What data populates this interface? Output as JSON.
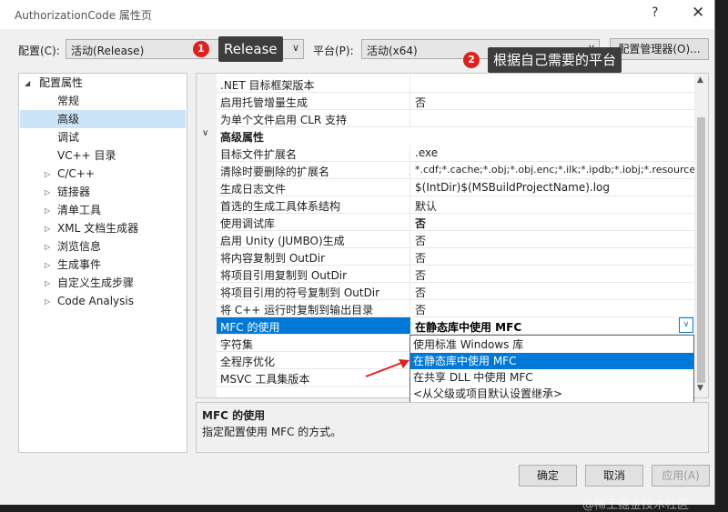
{
  "window": {
    "title": "AuthorizationCode 属性页",
    "help": "?",
    "close": "✕"
  },
  "toolbar": {
    "config_label": "配置(C):",
    "config_value": "活动(Release)",
    "platform_label": "平台(P):",
    "platform_value": "活动(x64)",
    "config_manager": "配置管理器(O)..."
  },
  "annotations": [
    {
      "number": "1",
      "text": "Release"
    },
    {
      "number": "2",
      "text": "根据自己需要的平台"
    }
  ],
  "tree": {
    "root": "配置属性",
    "items": [
      "常规",
      "高级",
      "调试",
      "VC++ 目录",
      "C/C++",
      "链接器",
      "清单工具",
      "XML 文档生成器",
      "浏览信息",
      "生成事件",
      "自定义生成步骤",
      "Code Analysis"
    ],
    "selected": "高级"
  },
  "grid": {
    "top_rows": [
      {
        "name": ".NET 目标框架版本",
        "value": ""
      },
      {
        "name": "启用托管增量生成",
        "value": "否"
      },
      {
        "name": "为单个文件启用 CLR 支持",
        "value": ""
      }
    ],
    "category": "高级属性",
    "rows": [
      {
        "name": "目标文件扩展名",
        "value": ".exe"
      },
      {
        "name": "清除时要删除的扩展名",
        "value": "*.cdf;*.cache;*.obj;*.obj.enc;*.ilk;*.ipdb;*.iobj;*.resources;"
      },
      {
        "name": "生成日志文件",
        "value": "$(IntDir)$(MSBuildProjectName).log"
      },
      {
        "name": "首选的生成工具体系结构",
        "value": "默认"
      },
      {
        "name": "使用调试库",
        "value": "否"
      },
      {
        "name": "启用 Unity (JUMBO)生成",
        "value": "否"
      },
      {
        "name": "将内容复制到 OutDir",
        "value": "否"
      },
      {
        "name": "将项目引用复制到 OutDir",
        "value": "否"
      },
      {
        "name": "将项目引用的符号复制到 OutDir",
        "value": "否"
      },
      {
        "name": "将 C++ 运行时复制到输出目录",
        "value": "否"
      },
      {
        "name": "MFC 的使用",
        "value": "在静态库中使用 MFC"
      },
      {
        "name": "字符集",
        "value": ""
      },
      {
        "name": "全程序优化",
        "value": ""
      },
      {
        "name": "MSVC 工具集版本",
        "value": ""
      }
    ]
  },
  "dropdown": {
    "options": [
      "使用标准 Windows 库",
      "在静态库中使用 MFC",
      "在共享 DLL 中使用 MFC",
      "<从父级或项目默认设置继承>"
    ],
    "selected": "在静态库中使用 MFC"
  },
  "description": {
    "title": "MFC 的使用",
    "text": "指定配置使用 MFC 的方式。"
  },
  "buttons": {
    "ok": "确定",
    "cancel": "取消",
    "apply": "应用(A)"
  },
  "watermark": "@稀土掘金技术社区",
  "colors": {
    "selection": "#0078d7",
    "badge": "#e0201d",
    "arrow": "#e0201d"
  }
}
